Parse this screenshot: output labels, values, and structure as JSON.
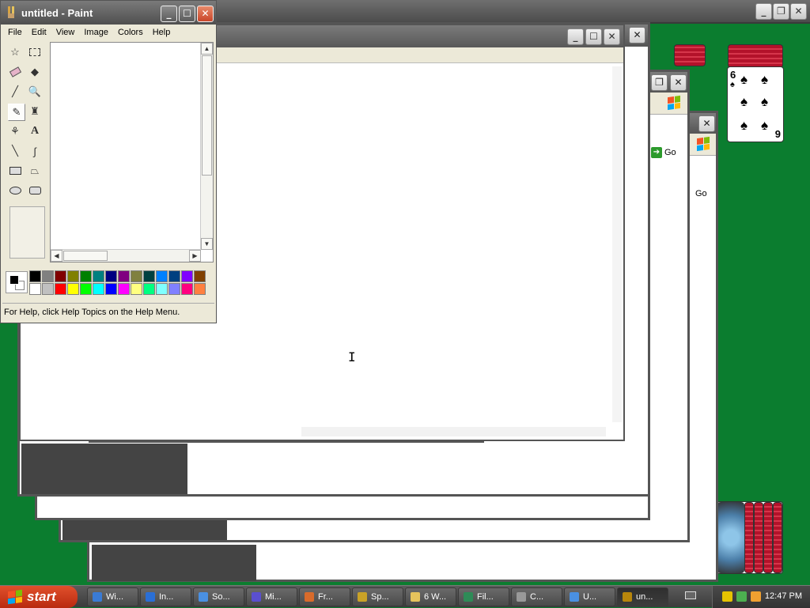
{
  "paint": {
    "title": "untitled - Paint",
    "menu": [
      "File",
      "Edit",
      "View",
      "Image",
      "Colors",
      "Help"
    ],
    "status": "For Help, click Help Topics on the Help Menu.",
    "palette_top": [
      "#000000",
      "#808080",
      "#800000",
      "#808000",
      "#008000",
      "#008080",
      "#000080",
      "#800080",
      "#808040",
      "#004040",
      "#0080ff",
      "#004080",
      "#8000ff",
      "#804000"
    ],
    "palette_bottom": [
      "#ffffff",
      "#c0c0c0",
      "#ff0000",
      "#ffff00",
      "#00ff00",
      "#00ffff",
      "#0000ff",
      "#ff00ff",
      "#ffff80",
      "#00ff80",
      "#80ffff",
      "#8080ff",
      "#ff0080",
      "#ff8040"
    ],
    "tools": [
      "free-select",
      "rect-select",
      "eraser",
      "fill",
      "color-picker",
      "magnifier",
      "pencil",
      "brush",
      "airbrush",
      "text",
      "line",
      "curve",
      "rectangle",
      "polygon",
      "ellipse",
      "rounded-rectangle"
    ],
    "selected_tool": "pencil"
  },
  "browser_windows": {
    "go_label": "Go"
  },
  "solitaire": {
    "card_top_label": "6",
    "card_bottom_label": "9",
    "suit": "♠"
  },
  "taskbar": {
    "start_label": "start",
    "items": [
      "Wi...",
      "In...",
      "So...",
      "Mi...",
      "Fr...",
      "Sp...",
      "6 W...",
      "Fil...",
      "C...",
      "U...",
      "un..."
    ],
    "item_colors": [
      "#3a7bd5",
      "#2a6fd6",
      "#4a90e2",
      "#5a4fcf",
      "#d96b2b",
      "#c9a227",
      "#e6c35c",
      "#2e8b57",
      "#999999",
      "#4a90e2",
      "#b8860b"
    ],
    "clock": "12:47 PM"
  },
  "colors": {
    "desktop": "#0b7d2f",
    "titlebar_grey": "#5f5f5f",
    "card_red": "#b3122a"
  }
}
